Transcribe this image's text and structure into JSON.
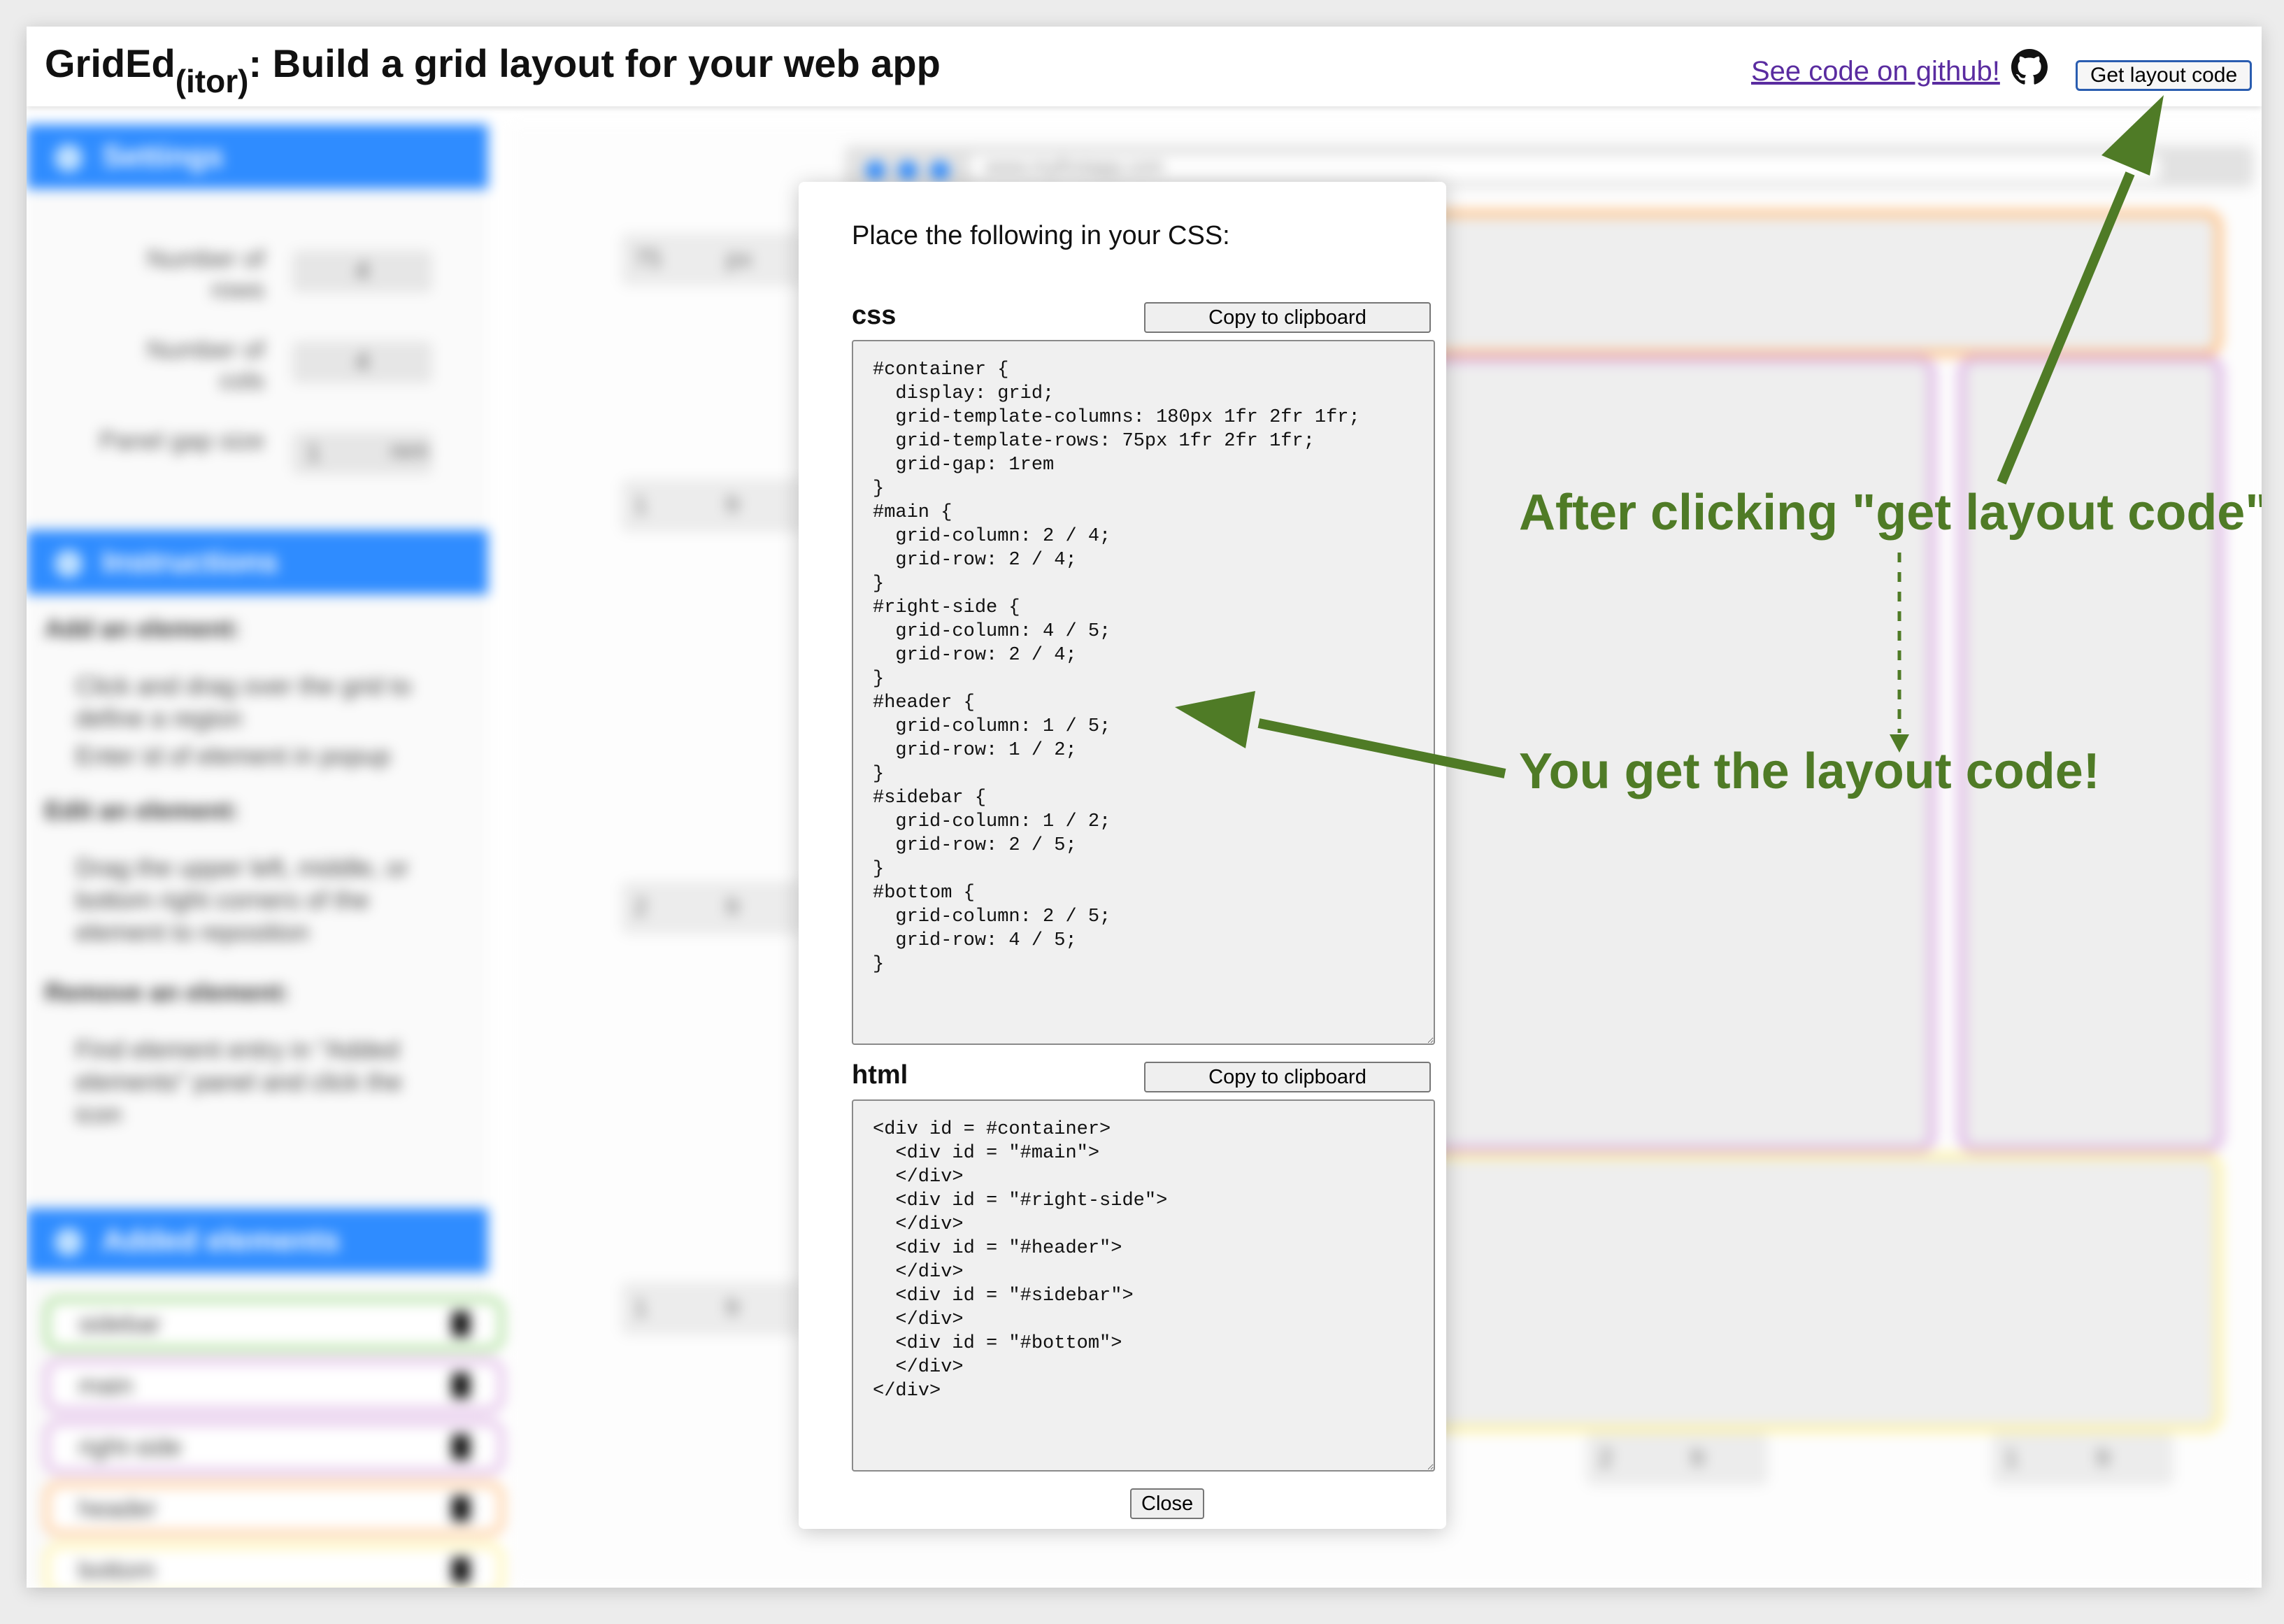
{
  "header": {
    "brand_main": "GridEd",
    "brand_sub": "(itor)",
    "brand_rest": ": Build a grid layout for your web app",
    "github_link": "See code on github!",
    "layout_button": "Get layout code"
  },
  "modal": {
    "title": "Place the following in your CSS:",
    "css_heading": "css",
    "html_heading": "html",
    "copy_label": "Copy to clipboard",
    "close_label": "Close",
    "css_code": "#container {\n  display: grid;\n  grid-template-columns: 180px 1fr 2fr 1fr;\n  grid-template-rows: 75px 1fr 2fr 1fr;\n  grid-gap: 1rem\n}\n#main {\n  grid-column: 2 / 4;\n  grid-row: 2 / 4;\n}\n#right-side {\n  grid-column: 4 / 5;\n  grid-row: 2 / 4;\n}\n#header {\n  grid-column: 1 / 5;\n  grid-row: 1 / 2;\n}\n#sidebar {\n  grid-column: 1 / 2;\n  grid-row: 2 / 5;\n}\n#bottom {\n  grid-column: 2 / 5;\n  grid-row: 4 / 5;\n}",
    "html_code": "<div id = #container>\n  <div id = \"#main\">\n  </div>\n  <div id = \"#right-side\">\n  </div>\n  <div id = \"#header\">\n  </div>\n  <div id = \"#sidebar\">\n  </div>\n  <div id = \"#bottom\">\n  </div>\n</div>"
  },
  "annotations": {
    "after_click": "After clicking \"get layout code\"",
    "result": "You get the layout code!"
  },
  "background": {
    "settings_title": "Settings",
    "rows_label": "Number of rows",
    "cols_label": "Number of cols",
    "gap_label": "Panel gap size",
    "rows_value": "4",
    "cols_value": "4",
    "gap_value": "1",
    "gap_unit": "rem",
    "instructions_title": "Instructions",
    "add_heading": "Add an element:",
    "add_bullet_1": "Click and drag over the grid to define a region",
    "add_bullet_2": "Enter id of element in popup",
    "edit_heading": "Edit an element:",
    "edit_bullet_1": "Drag the upper left, middle, or bottom right corners of the element to reposition",
    "remove_heading": "Remove an element:",
    "remove_bullet_1": "Find element entry in \"Added elements\" panel and click the icon",
    "added_title": "Added elements",
    "added_items": [
      "sidebar",
      "main",
      "right-side",
      "header",
      "bottom"
    ],
    "row_sizes": [
      "75",
      "1",
      "2",
      "1"
    ],
    "row_units": [
      "px",
      "fr",
      "fr",
      "fr"
    ],
    "col_sizes": [
      "2",
      "1"
    ],
    "col_units": [
      "fr",
      "fr"
    ],
    "url": "www.myfirstapp.com",
    "element_colors": {
      "sidebar": "#9ed68f",
      "main": "#d9a6e0",
      "right_side": "#d9a6e0",
      "header": "#ffbf80",
      "bottom": "#fff3a0"
    },
    "accent": "#2f8cff"
  }
}
